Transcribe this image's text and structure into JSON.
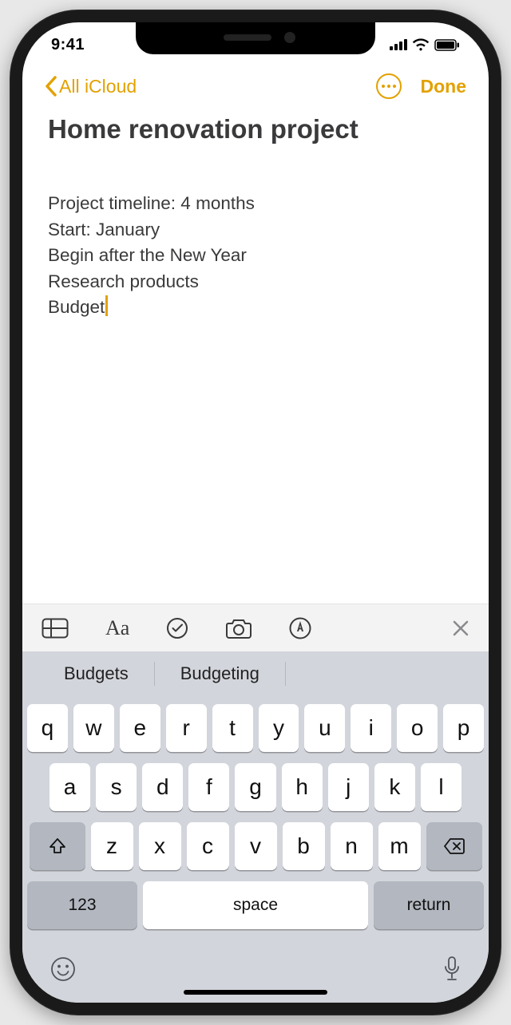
{
  "status": {
    "time": "9:41"
  },
  "nav": {
    "back_label": "All iCloud",
    "done_label": "Done"
  },
  "note": {
    "title": "Home renovation project",
    "body": "Project timeline: 4 months\nStart: January\nBegin after the New Year\nResearch products",
    "cursor_line": "Budget"
  },
  "suggestions": [
    "Budgets",
    "Budgeting"
  ],
  "keyboard": {
    "row1": [
      "q",
      "w",
      "e",
      "r",
      "t",
      "y",
      "u",
      "i",
      "o",
      "p"
    ],
    "row2": [
      "a",
      "s",
      "d",
      "f",
      "g",
      "h",
      "j",
      "k",
      "l"
    ],
    "row3": [
      "z",
      "x",
      "c",
      "v",
      "b",
      "n",
      "m"
    ],
    "numkey": "123",
    "space": "space",
    "return": "return"
  }
}
